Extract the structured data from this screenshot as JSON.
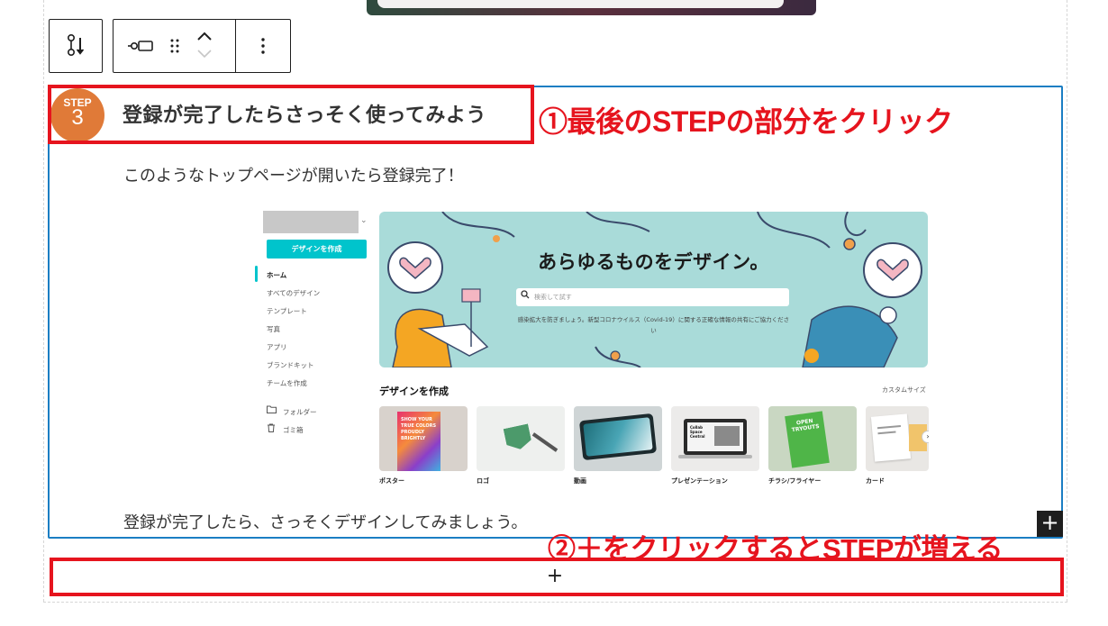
{
  "toolbar": {
    "icons": [
      "block-type-icon",
      "align-icon",
      "drag-handle-icon",
      "move-up-icon",
      "move-down-icon",
      "more-options-icon"
    ]
  },
  "step": {
    "badge_word": "STEP",
    "badge_number": "3",
    "title": "登録が完了したらさっそく使ってみよう",
    "paragraph_1": "このようなトップページが開いたら登録完了！",
    "paragraph_2": "登録が完了したら、さっそくデザインしてみましょう。"
  },
  "annotations": {
    "note_1": "①最後のSTEPの部分をクリック",
    "note_2": "②＋をクリックするとSTEPが増える"
  },
  "add_button": {
    "symbol": "+"
  },
  "inline_add": {
    "symbol": "+"
  },
  "embedded_screenshot": {
    "create_button": "デザインを作成",
    "nav_items": [
      "ホーム",
      "すべてのデザイン",
      "テンプレート",
      "写真",
      "アプリ",
      "ブランドキット",
      "チームを作成"
    ],
    "folder_items": [
      "フォルダー",
      "ゴミ箱"
    ],
    "hero_title": "あらゆるものをデザイン。",
    "search_placeholder": "検索して試す",
    "hero_notice": "感染拡大を防ぎましょう。新型コロナウイルス（Covid-19）に関する正確な情報の共有にご協力ください",
    "section_title": "デザインを作成",
    "custom_size": "カスタムサイズ",
    "templates": [
      "ポスター",
      "ロゴ",
      "動画",
      "プレゼンテーション",
      "チラシ/フライヤー",
      "カード"
    ],
    "poster_text": "SHOW YOUR TRUE COLORS PROUDLY BRIGHTLY",
    "flyer_text": "OPEN TRYOUTS",
    "presentation_text": "Collab Space Central"
  },
  "colors": {
    "accent_red": "#e6141e",
    "step_orange": "#e07a38",
    "selection_blue": "#1b7ec3",
    "canva_teal": "#00c4cc"
  }
}
